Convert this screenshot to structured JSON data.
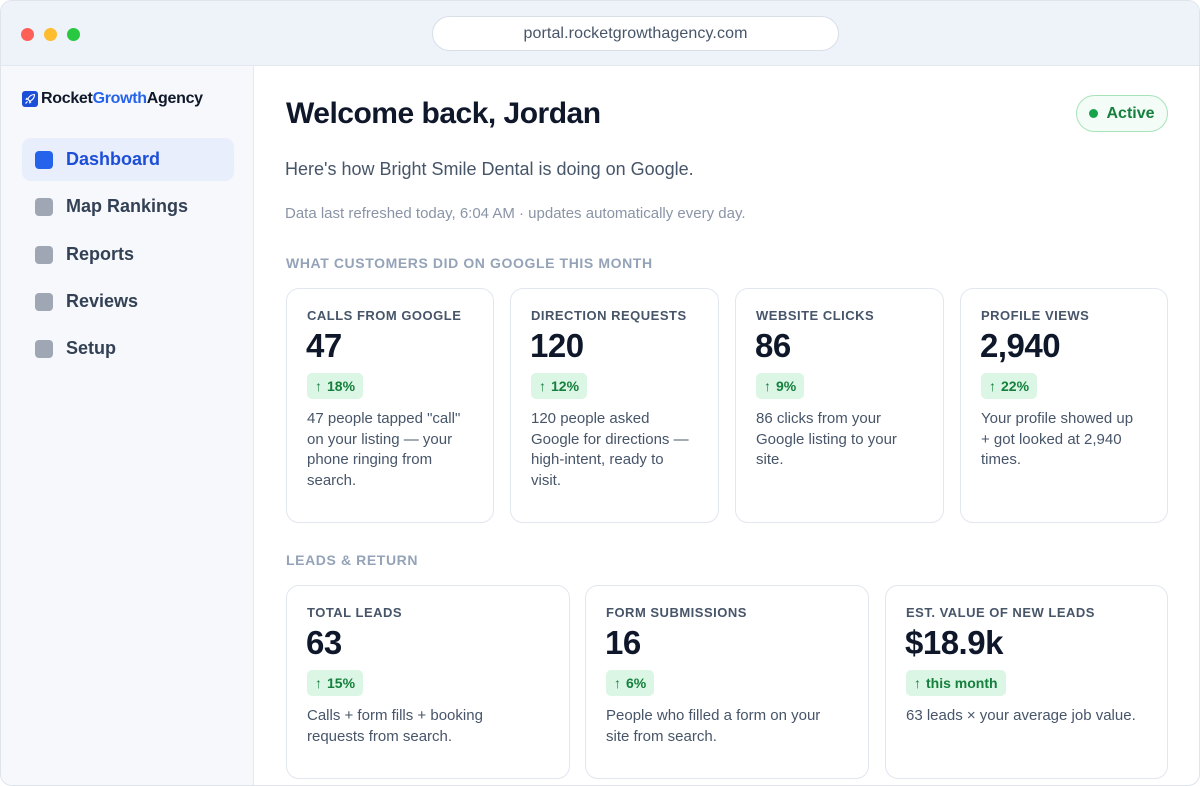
{
  "browser": {
    "url": "portal.rocketgrowthagency.com"
  },
  "brand": {
    "name_part1": "Rocket",
    "name_part2": "Growth",
    "name_part3": "Agency",
    "accent_color": "#2563eb"
  },
  "sidebar": {
    "items": [
      {
        "label": "Dashboard",
        "active": true
      },
      {
        "label": "Map Rankings",
        "active": false
      },
      {
        "label": "Reports",
        "active": false
      },
      {
        "label": "Reviews",
        "active": false
      },
      {
        "label": "Setup",
        "active": false
      }
    ]
  },
  "header": {
    "welcome": "Welcome back, Jordan",
    "status": "Active",
    "subtitle": "Here's how Bright Smile Dental is doing on Google.",
    "refresh": "Data last refreshed today, 6:04 AM · updates automatically every day."
  },
  "sections": {
    "customers_title": "WHAT CUSTOMERS DID ON GOOGLE THIS MONTH",
    "leads_title": "LEADS & RETURN"
  },
  "customer_cards": [
    {
      "label": "CALLS FROM GOOGLE",
      "value": "47",
      "trend": "18%",
      "desc_lines": [
        "47 people tapped \"call\"",
        "on your listing — your",
        "phone ringing from",
        "search."
      ]
    },
    {
      "label": "DIRECTION REQUESTS",
      "value": "120",
      "trend": "12%",
      "desc_lines": [
        "120 people asked",
        "Google for directions —",
        "high-intent, ready to",
        "visit."
      ]
    },
    {
      "label": "WEBSITE CLICKS",
      "value": "86",
      "trend": "9%",
      "desc_lines": [
        "86 clicks from your",
        "Google listing to your",
        "site."
      ]
    },
    {
      "label": "PROFILE VIEWS",
      "value": "2,940",
      "trend": "22%",
      "desc_lines": [
        "Your profile showed up",
        "+ got looked at 2,940",
        "times."
      ]
    }
  ],
  "lead_cards": [
    {
      "label": "TOTAL LEADS",
      "value": "63",
      "trend": "15%",
      "desc_lines": [
        "Calls + form fills + booking",
        "requests from search."
      ]
    },
    {
      "label": "FORM SUBMISSIONS",
      "value": "16",
      "trend": "6%",
      "desc_lines": [
        "People who filled a form on your",
        "site from search."
      ]
    },
    {
      "label": "EST. VALUE OF NEW LEADS",
      "value": "$18.9k",
      "trend": "this month",
      "desc_lines": [
        "63 leads × your average job value."
      ]
    }
  ],
  "icons": {
    "trend": "arrow-up-icon",
    "logo": "rocket-icon"
  },
  "colors": {
    "positive": "#15803d",
    "positive_bg": "#dcf6e5",
    "active_nav": "#2563eb"
  }
}
